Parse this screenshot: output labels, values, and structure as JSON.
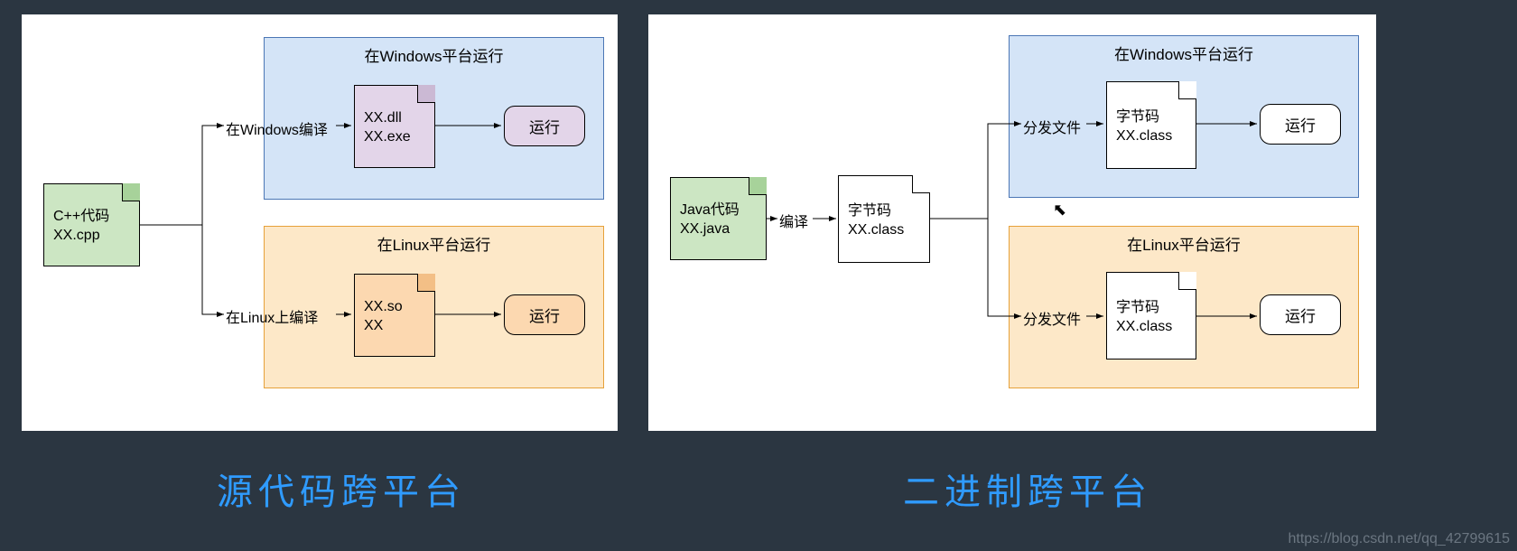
{
  "caption_left": "源代码跨平台",
  "caption_right": "二进制跨平台",
  "watermark": "https://blog.csdn.net/qq_42799615",
  "left": {
    "source": {
      "line1": "C++代码",
      "line2": "XX.cpp"
    },
    "windows": {
      "title": "在Windows平台运行",
      "compile": "在Windows编译",
      "out1": "XX.dll",
      "out2": "XX.exe",
      "run": "运行"
    },
    "linux": {
      "title": "在Linux平台运行",
      "compile": "在Linux上编译",
      "out1": "XX.so",
      "out2": "XX",
      "run": "运行"
    }
  },
  "right": {
    "source": {
      "line1": "Java代码",
      "line2": "XX.java"
    },
    "compile": "编译",
    "bytecode": {
      "line1": "字节码",
      "line2": "XX.class"
    },
    "windows": {
      "title": "在Windows平台运行",
      "dist": "分发文件",
      "out1": "字节码",
      "out2": "XX.class",
      "run": "运行"
    },
    "linux": {
      "title": "在Linux平台运行",
      "dist": "分发文件",
      "out1": "字节码",
      "out2": "XX.class",
      "run": "运行"
    }
  }
}
